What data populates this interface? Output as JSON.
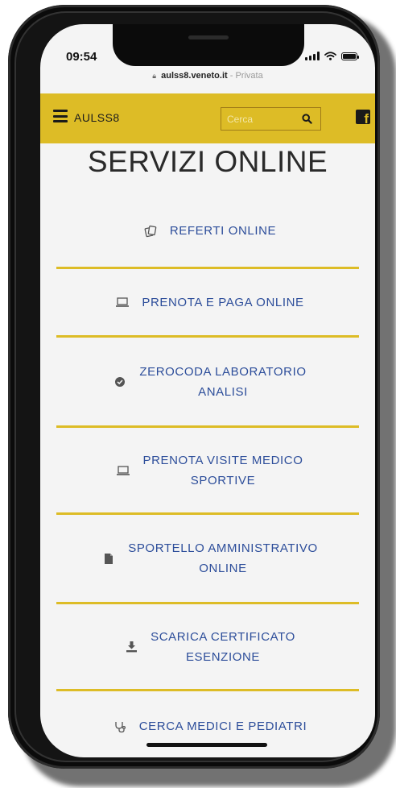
{
  "status_bar": {
    "time": "09:54"
  },
  "url_bar": {
    "domain": "aulss8.veneto.it",
    "separator": " - ",
    "mode": "Privata"
  },
  "nav": {
    "brand": "AULSS8",
    "search_placeholder": "Cerca",
    "accent_color": "#ddbc26"
  },
  "page": {
    "title": "SERVIZI ONLINE"
  },
  "services": [
    {
      "icon": "documents-icon",
      "label": "REFERTI ONLINE"
    },
    {
      "icon": "laptop-icon",
      "label": "PRENOTA E PAGA ONLINE"
    },
    {
      "icon": "circle-check-icon",
      "label_line1": "ZEROCODA LABORATORIO",
      "label_line2": "ANALISI"
    },
    {
      "icon": "laptop-icon",
      "label_line1": "PRENOTA VISITE MEDICO",
      "label_line2": "SPORTIVE"
    },
    {
      "icon": "file-icon",
      "label_line1": "SPORTELLO AMMINISTRATIVO",
      "label_line2": "ONLINE"
    },
    {
      "icon": "download-icon",
      "label_line1": "SCARICA CERTIFICATO",
      "label_line2": "ESENZIONE"
    },
    {
      "icon": "stethoscope-icon",
      "label": "CERCA MEDICI E PEDIATRI"
    }
  ],
  "colors": {
    "link": "#2c4d9a",
    "divider": "#ddbc26"
  }
}
